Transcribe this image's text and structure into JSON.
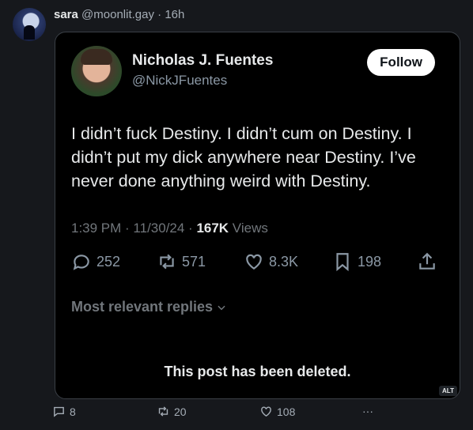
{
  "post": {
    "author_name": "sara",
    "author_handle": "@moonlit.gay",
    "separator": "·",
    "time": "16h",
    "reply_count": "8",
    "repost_count": "20",
    "like_count": "108",
    "more_label": "···"
  },
  "quoted": {
    "name": "Nicholas J. Fuentes",
    "handle": "@NickJFuentes",
    "follow_label": "Follow",
    "text": "I didn’t fuck Destiny. I didn’t cum on Destiny. I didn’t put my dick anywhere near Destiny. I’ve never done anything weird with Destiny.",
    "timestamp": "1:39 PM · 11/30/24 · ",
    "views_count": "167K",
    "views_label": " Views",
    "replies": "252",
    "reposts": "571",
    "likes": "8.3K",
    "bookmarks": "198",
    "replies_sort": "Most relevant replies",
    "deleted_notice": "This post has been deleted.",
    "alt_badge": "ALT"
  },
  "icons": {
    "reply": "speech-bubble-icon",
    "repost": "repost-arrows-icon",
    "like": "heart-icon",
    "bookmark": "bookmark-icon",
    "share": "share-upload-icon",
    "chevron": "chevron-down-icon"
  }
}
